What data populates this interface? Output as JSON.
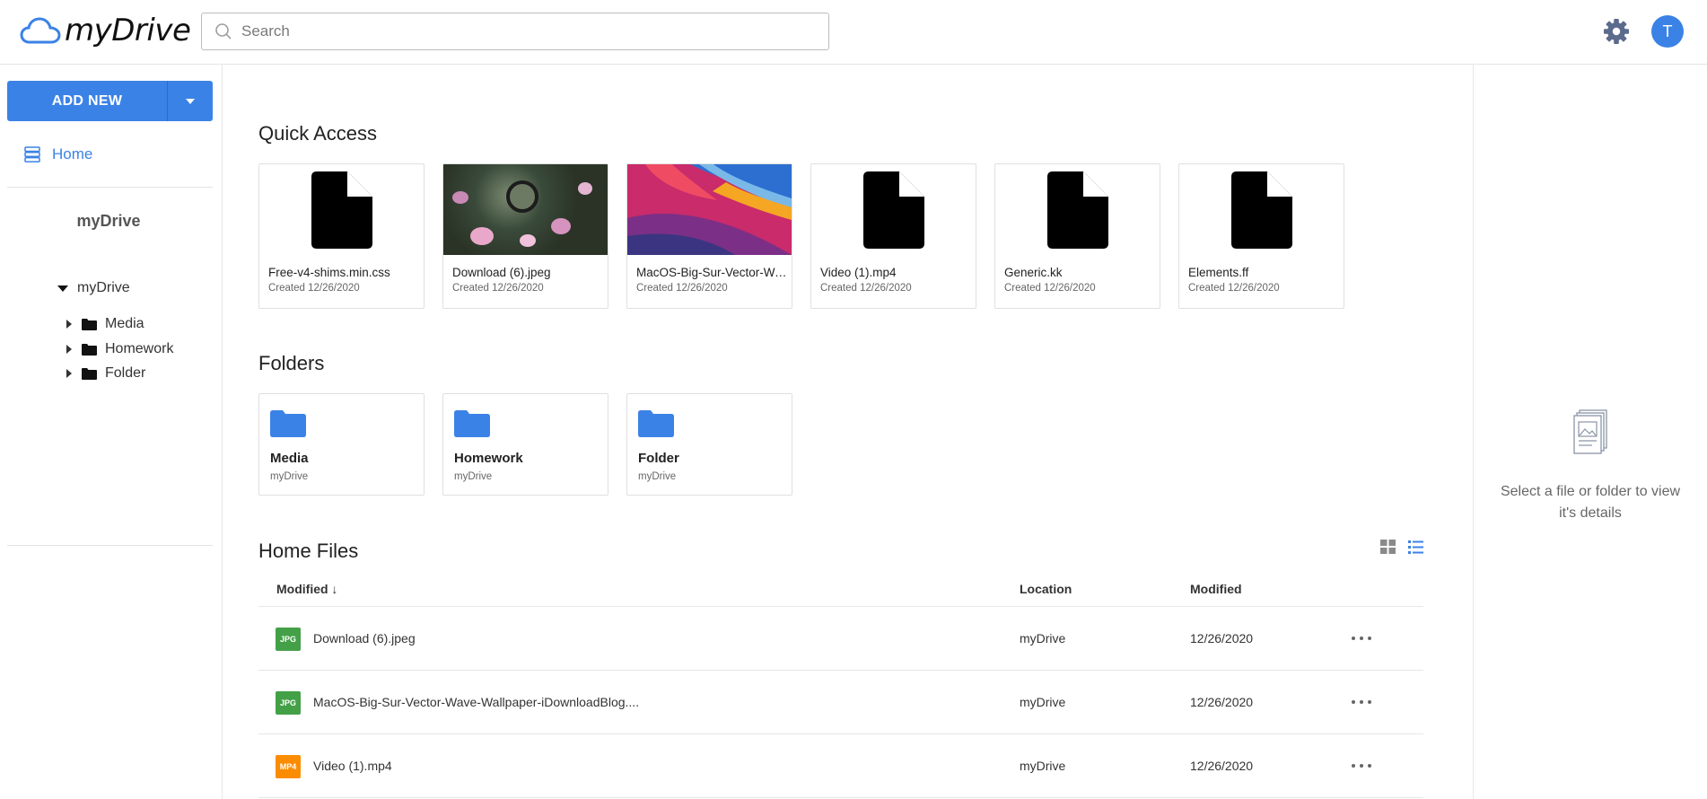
{
  "app": {
    "name": "myDrive"
  },
  "header": {
    "search_placeholder": "Search",
    "avatar_initial": "T"
  },
  "sidebar": {
    "add_new_label": "ADD NEW",
    "home_label": "Home",
    "drive_title": "myDrive",
    "tree_root": "myDrive",
    "tree_items": [
      "Media",
      "Homework",
      "Folder"
    ]
  },
  "quick_access": {
    "title": "Quick Access",
    "items": [
      {
        "name": "Free-v4-shims.min.css",
        "created": "Created 12/26/2020",
        "thumb": "file-icon"
      },
      {
        "name": "Download (6).jpeg",
        "created": "Created 12/26/2020",
        "thumb": "photo"
      },
      {
        "name": "MacOS-Big-Sur-Vector-Wave-Wallpaper-iDownloadBlog.jpg",
        "created": "Created 12/26/2020",
        "thumb": "wave"
      },
      {
        "name": "Video (1).mp4",
        "created": "Created 12/26/2020",
        "thumb": "file-icon"
      },
      {
        "name": "Generic.kk",
        "created": "Created 12/26/2020",
        "thumb": "file-icon"
      },
      {
        "name": "Elements.ff",
        "created": "Created 12/26/2020",
        "thumb": "file-icon"
      }
    ]
  },
  "folders": {
    "title": "Folders",
    "items": [
      {
        "name": "Media",
        "location": "myDrive"
      },
      {
        "name": "Homework",
        "location": "myDrive"
      },
      {
        "name": "Folder",
        "location": "myDrive"
      }
    ]
  },
  "home_files": {
    "title": "Home Files",
    "columns": {
      "name": "Modified ↓",
      "location": "Location",
      "modified": "Modified"
    },
    "rows": [
      {
        "badge": "JPG",
        "badge_color": "#43a047",
        "name": "Download (6).jpeg",
        "location": "myDrive",
        "modified": "12/26/2020"
      },
      {
        "badge": "JPG",
        "badge_color": "#43a047",
        "name": "MacOS-Big-Sur-Vector-Wave-Wallpaper-iDownloadBlog....",
        "location": "myDrive",
        "modified": "12/26/2020"
      },
      {
        "badge": "MP4",
        "badge_color": "#fb8c00",
        "name": "Video (1).mp4",
        "location": "myDrive",
        "modified": "12/26/2020"
      }
    ]
  },
  "details": {
    "empty_text": "Select a file or folder to view it's details"
  },
  "colors": {
    "accent": "#3b82e6",
    "folder": "#3b82e6"
  }
}
